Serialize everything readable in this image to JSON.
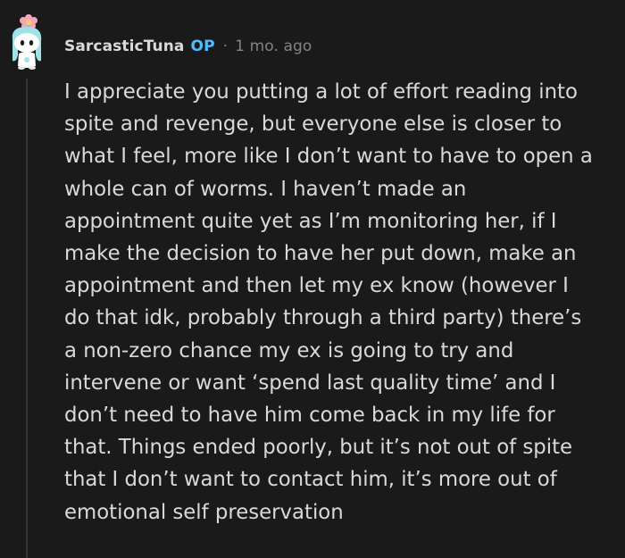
{
  "comment": {
    "author": "SarcasticTuna",
    "badge": "OP",
    "separator": "·",
    "timestamp": "1 mo. ago",
    "avatar_icon": "reddit-snoo-avatar-icon",
    "body": "I appreciate you putting a lot of effort reading into\nspite and revenge, but everyone else is closer to\nwhat I feel, more like I don’t want to have to open a\nwhole can of worms. I haven’t made an\nappointment quite yet as I’m monitoring her, if I\nmake the decision to have her put down, make an\nappointment and then let my ex know (however I\ndo that idk, probably through a third party) there’s\na non-zero chance my ex is going to try and\nintervene or want ‘spend last quality time’ and I\ndon’t need to have him come back in my life for\nthat. Things ended poorly, but it’s not out of spite\nthat I don’t want to contact him, it’s more out of\nemotional self preservation"
  },
  "colors": {
    "background": "#1a1a1b",
    "text": "#d7dadc",
    "op_badge": "#4fbcff",
    "muted": "#818384",
    "thread_line": "#343536"
  }
}
